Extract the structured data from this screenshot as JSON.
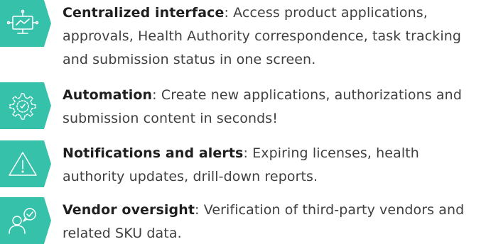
{
  "features": [
    {
      "icon": "monitor-network-icon",
      "title": "Centralized interface",
      "separator": ":",
      "description": " Access product applications, approvals, Health Authority correspondence, task tracking and submission status in one screen."
    },
    {
      "icon": "automation-gear-icon",
      "title": "Automation",
      "separator": ":",
      "description": " Create new applications, authorizations and submission content in seconds!"
    },
    {
      "icon": "warning-triangle-icon",
      "title": "Notifications and alerts",
      "separator": ":",
      "description": " Expiring licenses, health authority updates, drill-down reports."
    },
    {
      "icon": "user-verified-icon",
      "title": "Vendor oversight",
      "separator": ":",
      "description": " Verification of third-party vendors and related SKU data."
    }
  ],
  "colors": {
    "icon_background": "#36c1aa",
    "icon_stroke": "#ffffff",
    "title_text": "#1f1f1f",
    "body_text": "#3f3f3f"
  }
}
